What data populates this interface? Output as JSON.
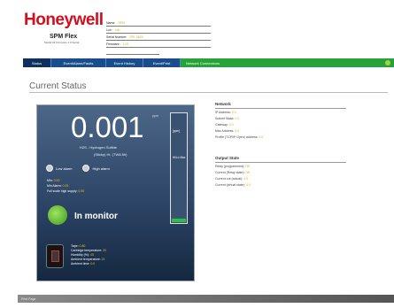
{
  "header": {
    "brand": "Honeywell",
    "device_name": "SPM Flex",
    "model_sub": "Model 01 Firmware 1.0 Serial",
    "fields": [
      {
        "label": "Name:",
        "value": "SPM"
      },
      {
        "label": "Loc:",
        "value": "Lab"
      },
      {
        "label": "Serial Number:",
        "value": "SPL 0624"
      },
      {
        "label": "Firmware:",
        "value": "1.00"
      },
      {
        "label": "",
        "value": ""
      }
    ]
  },
  "nav": {
    "tabs": [
      "Status",
      "Event/Alarm/Faults",
      "Event History",
      "Event/Print"
    ],
    "green_tab": "Network Connections"
  },
  "page_title": "Current Status",
  "monitor": {
    "reading": "0.001",
    "unit": "ppm",
    "gas_name": "H2S - Hydrogen Sulfide",
    "gas_sub": "(Sticky) Hr. (TWA 8h)",
    "alarms": [
      {
        "label": "Low alarm"
      },
      {
        "label": "High alarm"
      }
    ],
    "kvs": [
      {
        "label": "Min:",
        "value": "0.00"
      },
      {
        "label": "Min Alarm:",
        "value": "0.05"
      },
      {
        "label": "Full scale high supply:",
        "value": "0.50"
      }
    ],
    "bar": {
      "fill_fraction": 0.03,
      "top_label": "[ppm]",
      "mid_label": "Hi/Lo Max"
    },
    "state": "In monitor",
    "cartridge": [
      {
        "label": "Tape:",
        "value": "0.80"
      },
      {
        "label": "Cartridge temperature:",
        "value": "20"
      },
      {
        "label": "Humidity (%):",
        "value": "40"
      },
      {
        "label": "Ambient temperature:",
        "value": "21"
      },
      {
        "label": "Ambient time:",
        "value": "0.0"
      }
    ]
  },
  "network": {
    "title": "Network",
    "items": [
      {
        "label": "IP Address:",
        "value": "0.0"
      },
      {
        "label": "Subnet Mask:",
        "value": "0.0"
      },
      {
        "label": "Gateway:",
        "value": "0.0"
      },
      {
        "label": "Mac Address:",
        "value": "0.0"
      },
      {
        "label": "Profile (TCP/IP Open) address:",
        "value": "0.0"
      }
    ]
  },
  "output": {
    "title": "Output State",
    "items": [
      {
        "label": "Relay (programmed):",
        "value": "Off"
      },
      {
        "label": "Current (Relay state):",
        "value": "Off"
      },
      {
        "label": "Current out (actual):",
        "value": "4.0"
      },
      {
        "label": "Current (virtual state):",
        "value": "4.0"
      }
    ]
  },
  "footer": "Print Page"
}
